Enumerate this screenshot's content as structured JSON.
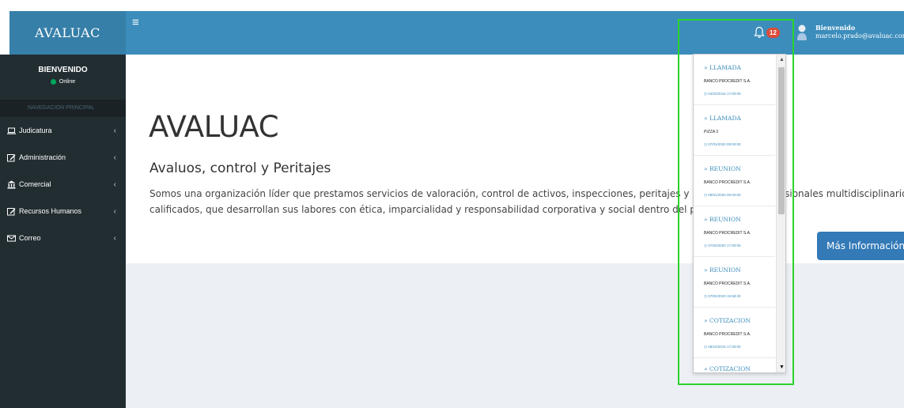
{
  "brand": "AVALUAC",
  "header": {
    "menu_icon": "hamburger-icon",
    "bell_icon": "bell-icon",
    "notification_count": "12",
    "user_icon": "user-icon",
    "welcome": "Bienvenido",
    "email": "marcelo.prado@avaluac.com"
  },
  "sidebar": {
    "user_name": "BIENVENIDO",
    "status": "Online",
    "nav_header": "NAVEGACION PRINCIPAL",
    "items": [
      {
        "label": "Judicatura",
        "icon": "laptop-icon"
      },
      {
        "label": "Administración",
        "icon": "edit-icon"
      },
      {
        "label": "Comercial",
        "icon": "bank-icon"
      },
      {
        "label": "Recursos Humanos",
        "icon": "edit-icon"
      },
      {
        "label": "Correo",
        "icon": "envelope-icon"
      }
    ]
  },
  "main": {
    "title": "AVALUAC",
    "subtitle": "Avaluos, control y Peritajes",
    "description_line1": "Somos una organización líder que prestamos servicios de valoración, control de activos, inspecciones, peritajes y asesorías con profesionales multidisciplinarios",
    "description_line2": "calificados, que desarrollan sus labores con ética, imparcialidad y responsabilidad corporativa y social dentro del país.",
    "more_button": "Más Información »"
  },
  "notifications": [
    {
      "title": "» LLAMADA",
      "client": "BANCO PROCREDIT S.A.",
      "time": "04/03/2015 17:00:00"
    },
    {
      "title": "» LLAMADA",
      "client": "PIZZA 3",
      "time": "07/01/2020 09:00:00"
    },
    {
      "title": "» REUNION",
      "client": "BANCO PROCREDIT S.A.",
      "time": "08/01/2020 00:00:00"
    },
    {
      "title": "» REUNION",
      "client": "BANCO PROCREDIT S.A.",
      "time": "07/02/2020 17:00:00"
    },
    {
      "title": "» REUNION",
      "client": "BANCO PROCREDIT S.A.",
      "time": "07/02/2020 15:58:20"
    },
    {
      "title": "» COTIZACION",
      "client": "BANCO PROCREDIT S.A.",
      "time": "08/10/2015 17:00:00"
    },
    {
      "title": "» COTIZACION"
    }
  ],
  "colors": {
    "header": "#3c8dbc",
    "logo": "#367fa9",
    "sidebar": "#222d32",
    "badge": "#dd4b39",
    "online": "#00a65a",
    "button": "#337ab7",
    "highlight": "#2bd32b"
  }
}
